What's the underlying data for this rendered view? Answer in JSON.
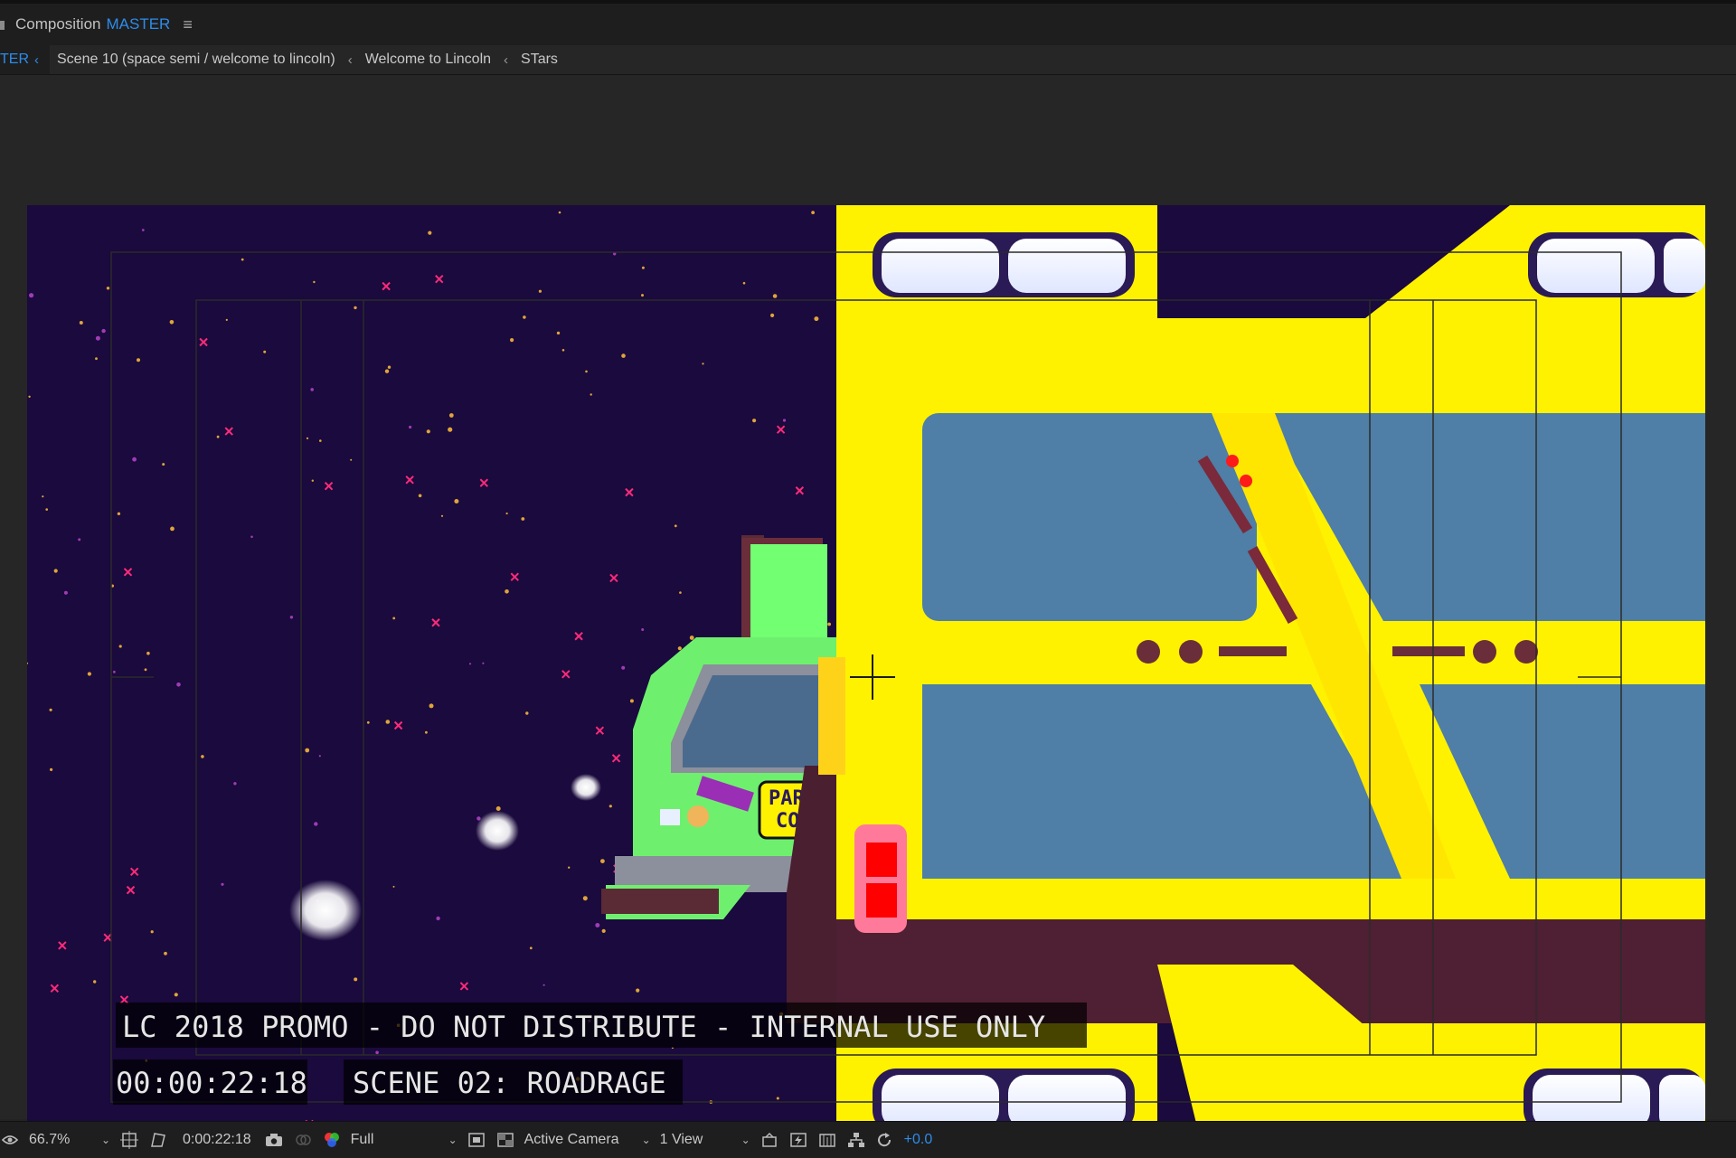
{
  "panel": {
    "prefix": "Composition",
    "name": "MASTER",
    "menu_icon": "hamburger-icon"
  },
  "breadcrumbs": {
    "current": "TER",
    "items": [
      "Scene 10 (space semi / welcome to lincoln)",
      "Welcome to Lincoln",
      "STars"
    ]
  },
  "overlay": {
    "slate": "LC 2018 PROMO - DO NOT DISTRIBUTE - INTERNAL USE ONLY",
    "timecode": "00:00:22:18",
    "scene": "SCENE 02: ROADRAGE",
    "sticker_line1": "PARO",
    "sticker_line2": "COU"
  },
  "bottom_bar": {
    "zoom": "66.7%",
    "current_time": "0:00:22:18",
    "resolution": "Full",
    "camera": "Active Camera",
    "views": "1 View",
    "exposure": "+0.0"
  },
  "colors": {
    "accent": "#2d8ceb",
    "sky": "#1a0a3d",
    "bus_yellow": "#fff200",
    "window_blue": "#4f7ea6",
    "car_green": "#6ef06e"
  }
}
